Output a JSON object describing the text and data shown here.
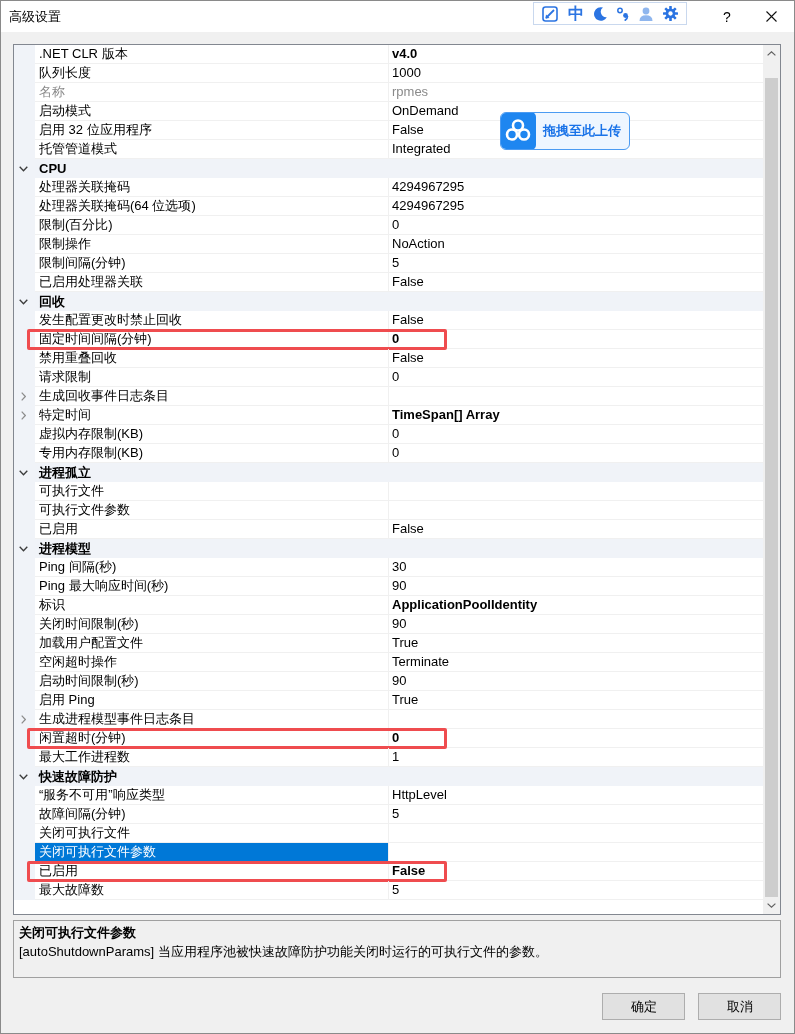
{
  "window": {
    "title": "高级设置",
    "help_label": "?"
  },
  "ime_toolbar": {
    "mode_label": "中"
  },
  "property_grid": {
    "sections": [
      {
        "rows": [
          {
            "name": ".NET CLR 版本",
            "value": "v4.0",
            "kind": "leaf",
            "modified": true,
            "readonly": false,
            "selected": false,
            "annotated": false
          },
          {
            "name": "队列长度",
            "value": "1000",
            "kind": "leaf",
            "modified": false,
            "readonly": false,
            "selected": false,
            "annotated": false
          },
          {
            "name": "名称",
            "value": "rpmes",
            "kind": "leaf",
            "modified": false,
            "readonly": true,
            "selected": false,
            "annotated": false
          },
          {
            "name": "启动模式",
            "value": "OnDemand",
            "kind": "leaf",
            "modified": false,
            "readonly": false,
            "selected": false,
            "annotated": false
          },
          {
            "name": "启用 32 位应用程序",
            "value": "False",
            "kind": "leaf",
            "modified": false,
            "readonly": false,
            "selected": false,
            "annotated": false
          },
          {
            "name": "托管管道模式",
            "value": "Integrated",
            "kind": "leaf",
            "modified": false,
            "readonly": false,
            "selected": false,
            "annotated": false
          }
        ]
      },
      {
        "header": "CPU",
        "expanded": true,
        "rows": [
          {
            "name": "处理器关联掩码",
            "value": "4294967295",
            "kind": "leaf",
            "modified": false,
            "readonly": false,
            "selected": false,
            "annotated": false
          },
          {
            "name": "处理器关联掩码(64 位选项)",
            "value": "4294967295",
            "kind": "leaf",
            "modified": false,
            "readonly": false,
            "selected": false,
            "annotated": false
          },
          {
            "name": "限制(百分比)",
            "value": "0",
            "kind": "leaf",
            "modified": false,
            "readonly": false,
            "selected": false,
            "annotated": false
          },
          {
            "name": "限制操作",
            "value": "NoAction",
            "kind": "leaf",
            "modified": false,
            "readonly": false,
            "selected": false,
            "annotated": false
          },
          {
            "name": "限制间隔(分钟)",
            "value": "5",
            "kind": "leaf",
            "modified": false,
            "readonly": false,
            "selected": false,
            "annotated": false
          },
          {
            "name": "已启用处理器关联",
            "value": "False",
            "kind": "leaf",
            "modified": false,
            "readonly": false,
            "selected": false,
            "annotated": false
          }
        ]
      },
      {
        "header": "回收",
        "expanded": true,
        "rows": [
          {
            "name": "发生配置更改时禁止回收",
            "value": "False",
            "kind": "leaf",
            "modified": false,
            "readonly": false,
            "selected": false,
            "annotated": false
          },
          {
            "name": "固定时间间隔(分钟)",
            "value": "0",
            "kind": "leaf",
            "modified": true,
            "readonly": false,
            "selected": false,
            "annotated": true
          },
          {
            "name": "禁用重叠回收",
            "value": "False",
            "kind": "leaf",
            "modified": false,
            "readonly": false,
            "selected": false,
            "annotated": false
          },
          {
            "name": "请求限制",
            "value": "0",
            "kind": "leaf",
            "modified": false,
            "readonly": false,
            "selected": false,
            "annotated": false
          },
          {
            "name": "生成回收事件日志条目",
            "kind": "branch",
            "expanded": false,
            "modified": false,
            "readonly": false,
            "selected": false,
            "annotated": false
          },
          {
            "name": "特定时间",
            "value": "TimeSpan[] Array",
            "kind": "branch",
            "expanded": false,
            "modified": true,
            "readonly": false,
            "selected": false,
            "annotated": false
          },
          {
            "name": "虚拟内存限制(KB)",
            "value": "0",
            "kind": "leaf",
            "modified": false,
            "readonly": false,
            "selected": false,
            "annotated": false
          },
          {
            "name": "专用内存限制(KB)",
            "value": "0",
            "kind": "leaf",
            "modified": false,
            "readonly": false,
            "selected": false,
            "annotated": false
          }
        ]
      },
      {
        "header": "进程孤立",
        "expanded": true,
        "rows": [
          {
            "name": "可执行文件",
            "kind": "leaf",
            "modified": false,
            "readonly": false,
            "selected": false,
            "annotated": false
          },
          {
            "name": "可执行文件参数",
            "kind": "leaf",
            "modified": false,
            "readonly": false,
            "selected": false,
            "annotated": false
          },
          {
            "name": "已启用",
            "value": "False",
            "kind": "leaf",
            "modified": false,
            "readonly": false,
            "selected": false,
            "annotated": false
          }
        ]
      },
      {
        "header": "进程模型",
        "expanded": true,
        "rows": [
          {
            "name": "Ping 间隔(秒)",
            "value": "30",
            "kind": "leaf",
            "modified": false,
            "readonly": false,
            "selected": false,
            "annotated": false
          },
          {
            "name": "Ping 最大响应时间(秒)",
            "value": "90",
            "kind": "leaf",
            "modified": false,
            "readonly": false,
            "selected": false,
            "annotated": false
          },
          {
            "name": "标识",
            "value": "ApplicationPoolIdentity",
            "kind": "leaf",
            "modified": true,
            "readonly": false,
            "selected": false,
            "annotated": false
          },
          {
            "name": "关闭时间限制(秒)",
            "value": "90",
            "kind": "leaf",
            "modified": false,
            "readonly": false,
            "selected": false,
            "annotated": false
          },
          {
            "name": "加载用户配置文件",
            "value": "True",
            "kind": "leaf",
            "modified": false,
            "readonly": false,
            "selected": false,
            "annotated": false
          },
          {
            "name": "空闲超时操作",
            "value": "Terminate",
            "kind": "leaf",
            "modified": false,
            "readonly": false,
            "selected": false,
            "annotated": false
          },
          {
            "name": "启动时间限制(秒)",
            "value": "90",
            "kind": "leaf",
            "modified": false,
            "readonly": false,
            "selected": false,
            "annotated": false
          },
          {
            "name": "启用 Ping",
            "value": "True",
            "kind": "leaf",
            "modified": false,
            "readonly": false,
            "selected": false,
            "annotated": false
          },
          {
            "name": "生成进程模型事件日志条目",
            "kind": "branch",
            "expanded": false,
            "modified": false,
            "readonly": false,
            "selected": false,
            "annotated": false
          },
          {
            "name": "闲置超时(分钟)",
            "value": "0",
            "kind": "leaf",
            "modified": true,
            "readonly": false,
            "selected": false,
            "annotated": true
          },
          {
            "name": "最大工作进程数",
            "value": "1",
            "kind": "leaf",
            "modified": false,
            "readonly": false,
            "selected": false,
            "annotated": false
          }
        ]
      },
      {
        "header": "快速故障防护",
        "expanded": true,
        "rows": [
          {
            "name": "“服务不可用”响应类型",
            "value": "HttpLevel",
            "kind": "leaf",
            "modified": false,
            "readonly": false,
            "selected": false,
            "annotated": false
          },
          {
            "name": "故障间隔(分钟)",
            "value": "5",
            "kind": "leaf",
            "modified": false,
            "readonly": false,
            "selected": false,
            "annotated": false
          },
          {
            "name": "关闭可执行文件",
            "kind": "leaf",
            "modified": false,
            "readonly": false,
            "selected": false,
            "annotated": false
          },
          {
            "name": "关闭可执行文件参数",
            "kind": "leaf",
            "modified": false,
            "readonly": false,
            "selected": true,
            "annotated": false
          },
          {
            "name": "已启用",
            "value": "False",
            "kind": "leaf",
            "modified": true,
            "readonly": false,
            "selected": false,
            "annotated": true
          },
          {
            "name": "最大故障数",
            "value": "5",
            "kind": "leaf",
            "modified": false,
            "readonly": false,
            "selected": false,
            "annotated": false
          }
        ]
      }
    ]
  },
  "upload_badge": {
    "label": "拖拽至此上传"
  },
  "description": {
    "title": "关闭可执行文件参数",
    "text": "[autoShutdownParams] 当应用程序池被快速故障防护功能关闭时运行的可执行文件的参数。"
  },
  "buttons": [
    {
      "label": "确定"
    },
    {
      "label": "取消"
    }
  ]
}
